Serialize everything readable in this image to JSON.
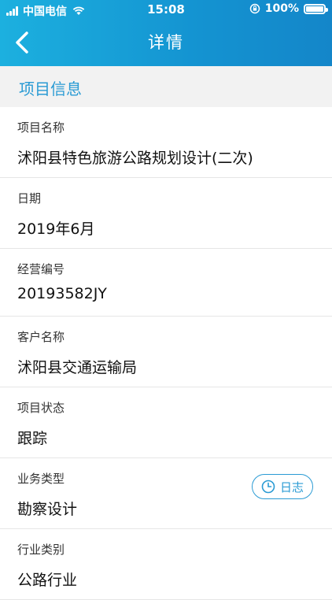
{
  "status_bar": {
    "carrier": "中国电信",
    "time": "15:08",
    "battery": "100%"
  },
  "nav": {
    "title": "详情",
    "back_icon": "chevron-left-icon"
  },
  "section": {
    "title": "项目信息"
  },
  "fields": [
    {
      "label": "项目名称",
      "value": "沭阳县特色旅游公路规划设计(二次)"
    },
    {
      "label": "日期",
      "value": "2019年6月"
    },
    {
      "label": "经营编号",
      "value": "20193582JY"
    },
    {
      "label": "客户名称",
      "value": "沭阳县交通运输局"
    },
    {
      "label": "项目状态",
      "value": "跟踪"
    },
    {
      "label": "业务类型",
      "value": "勘察设计"
    },
    {
      "label": "行业类别",
      "value": "公路行业"
    }
  ],
  "log_button": {
    "label": "日志",
    "icon": "clock-icon"
  },
  "colors": {
    "header_start": "#1cb0df",
    "header_end": "#1486c9",
    "accent": "#2a9bd4",
    "section_bg": "#f2f2f2"
  }
}
